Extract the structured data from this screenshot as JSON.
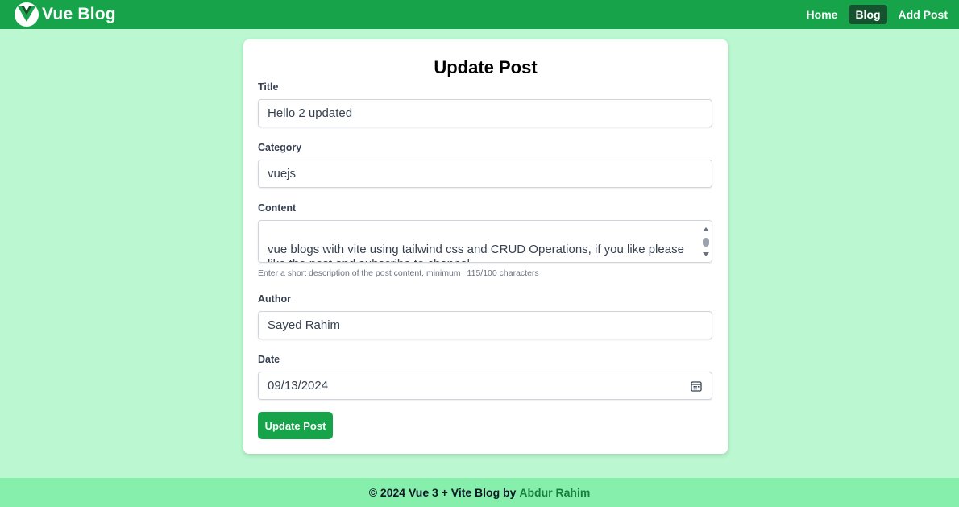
{
  "header": {
    "brand": "Vue Blog",
    "brand_logo_icon": "vue-logo-icon",
    "nav": [
      {
        "label": "Home",
        "active": false
      },
      {
        "label": "Blog",
        "active": true
      },
      {
        "label": "Add Post",
        "active": false
      }
    ]
  },
  "form": {
    "heading": "Update Post",
    "title": {
      "label": "Title",
      "value": "Hello 2 updated"
    },
    "category": {
      "label": "Category",
      "value": "vuejs"
    },
    "content": {
      "label": "Content",
      "value": "vue blogs with vite using tailwind css and CRUD Operations, if you like please like the post and subscribe to channel",
      "hint": "Enter a short description of the post content, minimum",
      "count": "115/100 characters"
    },
    "author": {
      "label": "Author",
      "value": "Sayed Rahim"
    },
    "date": {
      "label": "Date",
      "value": "09/13/2024",
      "icon": "calendar-icon"
    },
    "submit_label": "Update Post"
  },
  "footer": {
    "text": "© 2024 Vue 3 + Vite Blog by",
    "author": "Abdur Rahim"
  },
  "colors": {
    "primary": "#16a34a",
    "page_bg": "#bbf7d0",
    "footer_bg": "#86efac",
    "nav_active": "#14532d",
    "author_link": "#15803d"
  }
}
